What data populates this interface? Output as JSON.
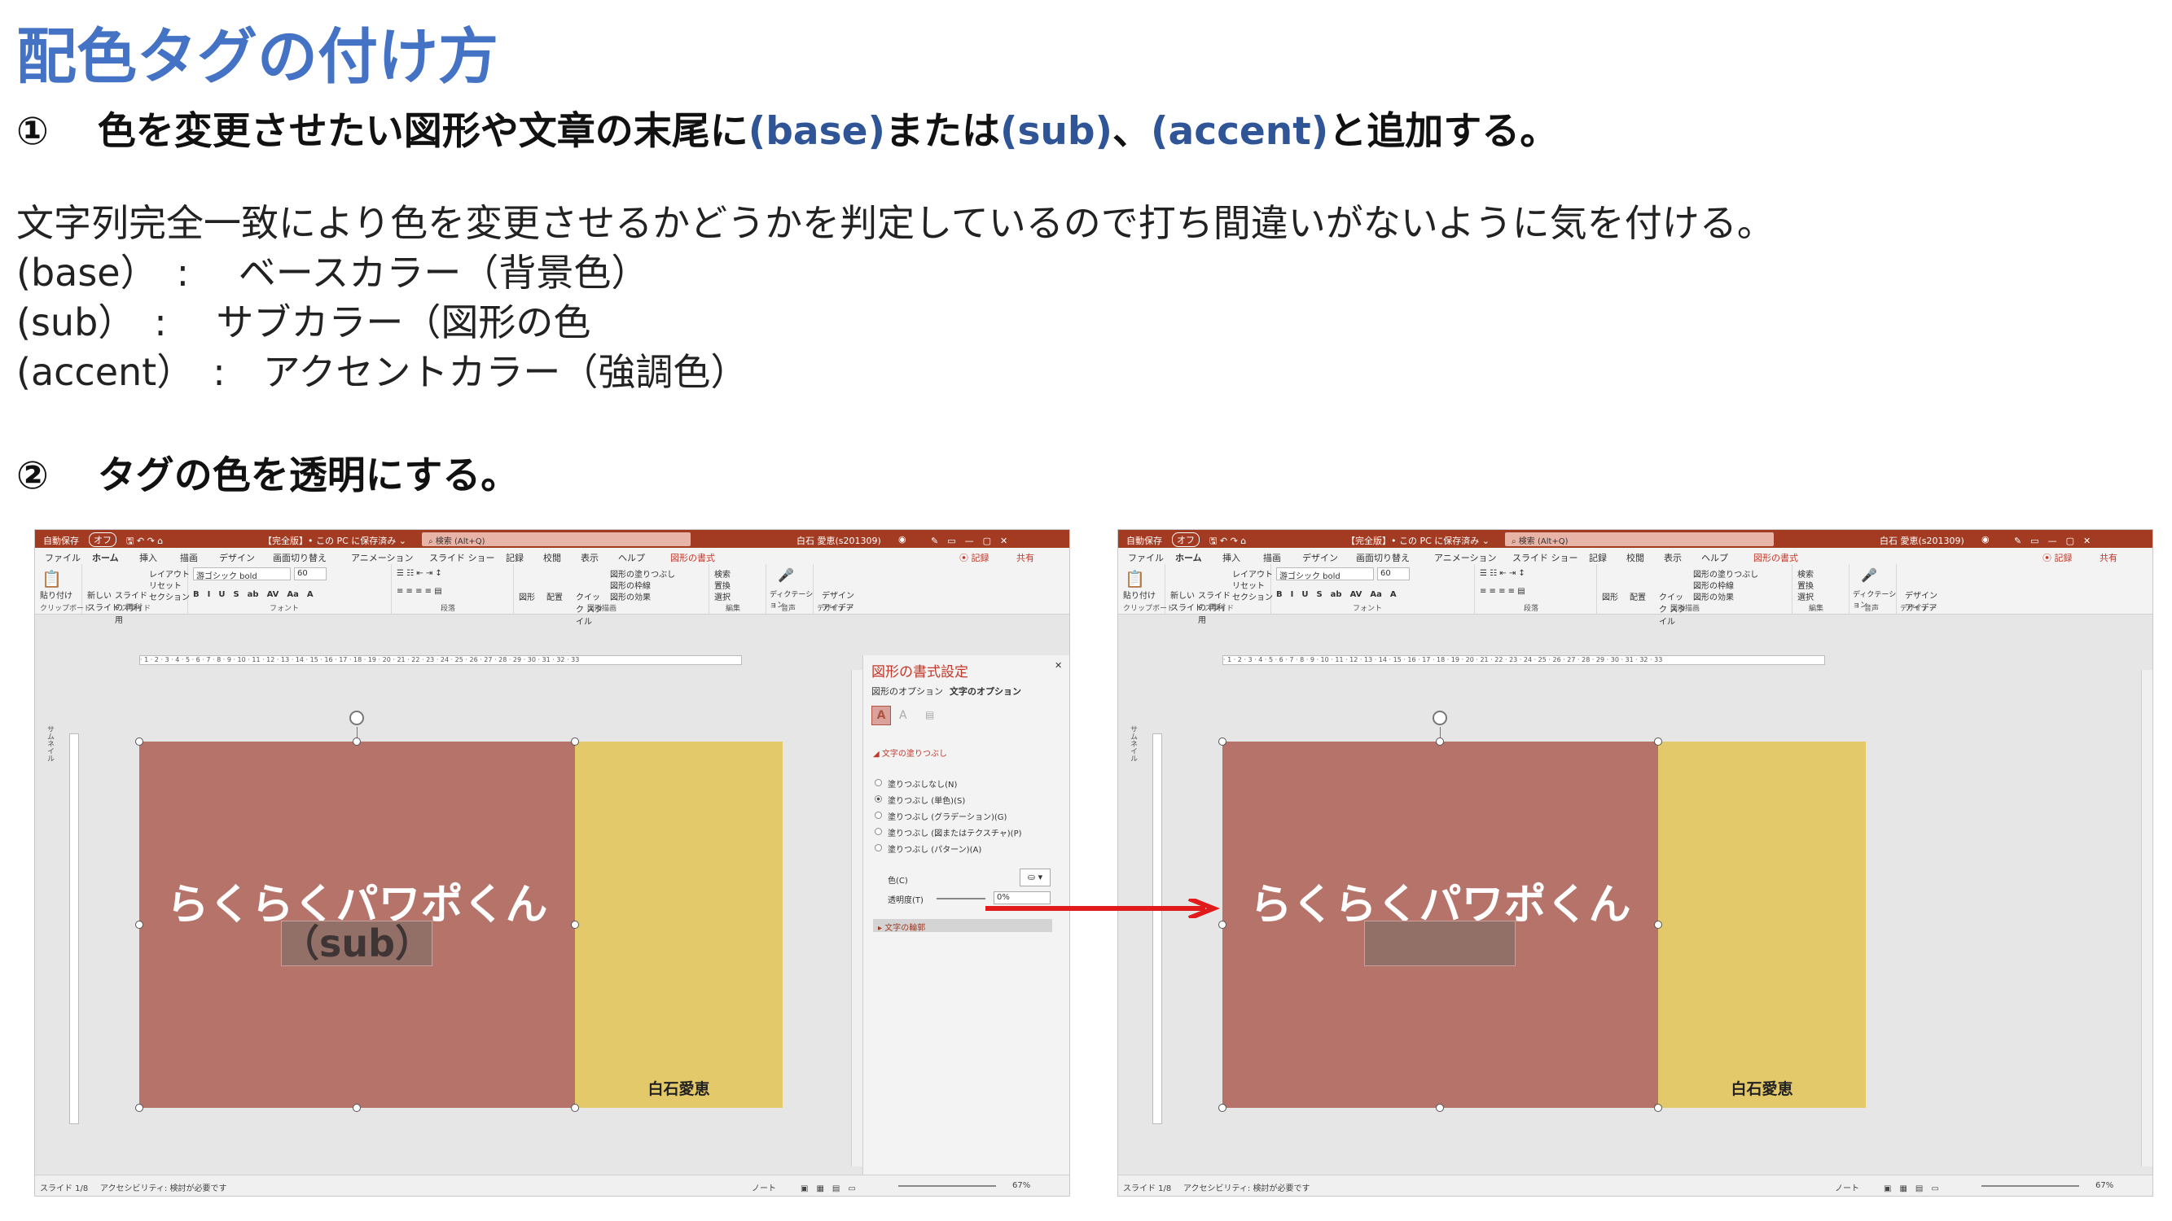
{
  "title": "配色タグの付け方",
  "step1": {
    "num": "①",
    "text_a": "色を変更させたい図形や文章の末尾に",
    "tag_base": "(base)",
    "text_b": "または",
    "tag_sub": "(sub)",
    "text_c": "、",
    "tag_accent": "(accent)",
    "text_d": "と追加する。"
  },
  "description": [
    "文字列完全一致により色を変更させるかどうかを判定しているので打ち間違いがないように気を付ける。",
    "(base）　:　 ベースカラー（背景色）",
    "(sub）　:　 サブカラー（図形の色",
    "(accent）　:　アクセントカラー（強調色）"
  ],
  "step2": {
    "num": "②",
    "text": "タグの色を透明にする。"
  },
  "app": {
    "autosave": "自動保存",
    "toggle": "オフ",
    "doc_title": "【完全版】• この PC に保存済み ⌄",
    "search": "検索 (Alt+Q)",
    "user": "白石 愛恵(s201309)",
    "menu": [
      "ファイル",
      "ホーム",
      "挿入",
      "描画",
      "デザイン",
      "画面切り替え",
      "アニメーション",
      "スライド ショー",
      "記録",
      "校閲",
      "表示",
      "ヘルプ",
      "図形の書式"
    ],
    "record": "⦿ 記録",
    "share": "共有",
    "ribbon": {
      "paste": "貼り付け",
      "new_slide": "新しい スライド",
      "reuse": "スライドの 再利用",
      "layout": "レイアウト",
      "reset": "リセット",
      "section": "セクション",
      "font": "游ゴシック bold",
      "size": "60",
      "shape": "図形",
      "arrange": "配置",
      "quick": "クイック スタイル",
      "fill": "図形の塗りつぶし",
      "outline": "図形の枠線",
      "effect": "図形の効果",
      "find": "検索",
      "replace": "置換",
      "select": "選択",
      "dictate": "ディクテーション",
      "designer": "デザイン アイデア",
      "groups": [
        "クリップボード",
        "スライド",
        "フォント",
        "段落",
        "図形描画",
        "編集",
        "音声",
        "デザイナー"
      ]
    },
    "ruler": "· 1 · 2 · 3 · 4 · 5 · 6 · 7 · 8 · 9 · 10 · 11 · 12 · 13 · 14 · 15 · 16 · 17 · 18 · 19 · 20 · 21 · 22 · 23 · 24 · 25 · 26 · 27 · 28 · 29 · 30 · 31 · 32 · 33",
    "thumb_label": "サムネイル",
    "status": {
      "slide": "スライド 1/8",
      "access": "アクセシビリティ: 検討が必要です",
      "notes": "ノート",
      "zoom": "67%"
    }
  },
  "slide": {
    "main": "らくらくパワポくん",
    "tag": "（sub）",
    "author": "白石愛恵"
  },
  "panel": {
    "title": "図形の書式設定",
    "tab1": "図形のオプション",
    "tab2": "文字のオプション",
    "section": "文字の塗りつぶし",
    "options": [
      "塗りつぶしなし(N)",
      "塗りつぶし (単色)(S)",
      "塗りつぶし (グラデーション)(G)",
      "塗りつぶし (図またはテクスチャ)(P)",
      "塗りつぶし (パターン)(A)"
    ],
    "color": "色(C)",
    "transparency": "透明度(T)",
    "transparency_val": "0%",
    "outline": "文字の輪郭"
  },
  "colors": {
    "shape_red": "#b5736a",
    "shape_yellow": "#e4c96a",
    "title_blue": "#4472c4",
    "arrow": "#e11b1b"
  }
}
